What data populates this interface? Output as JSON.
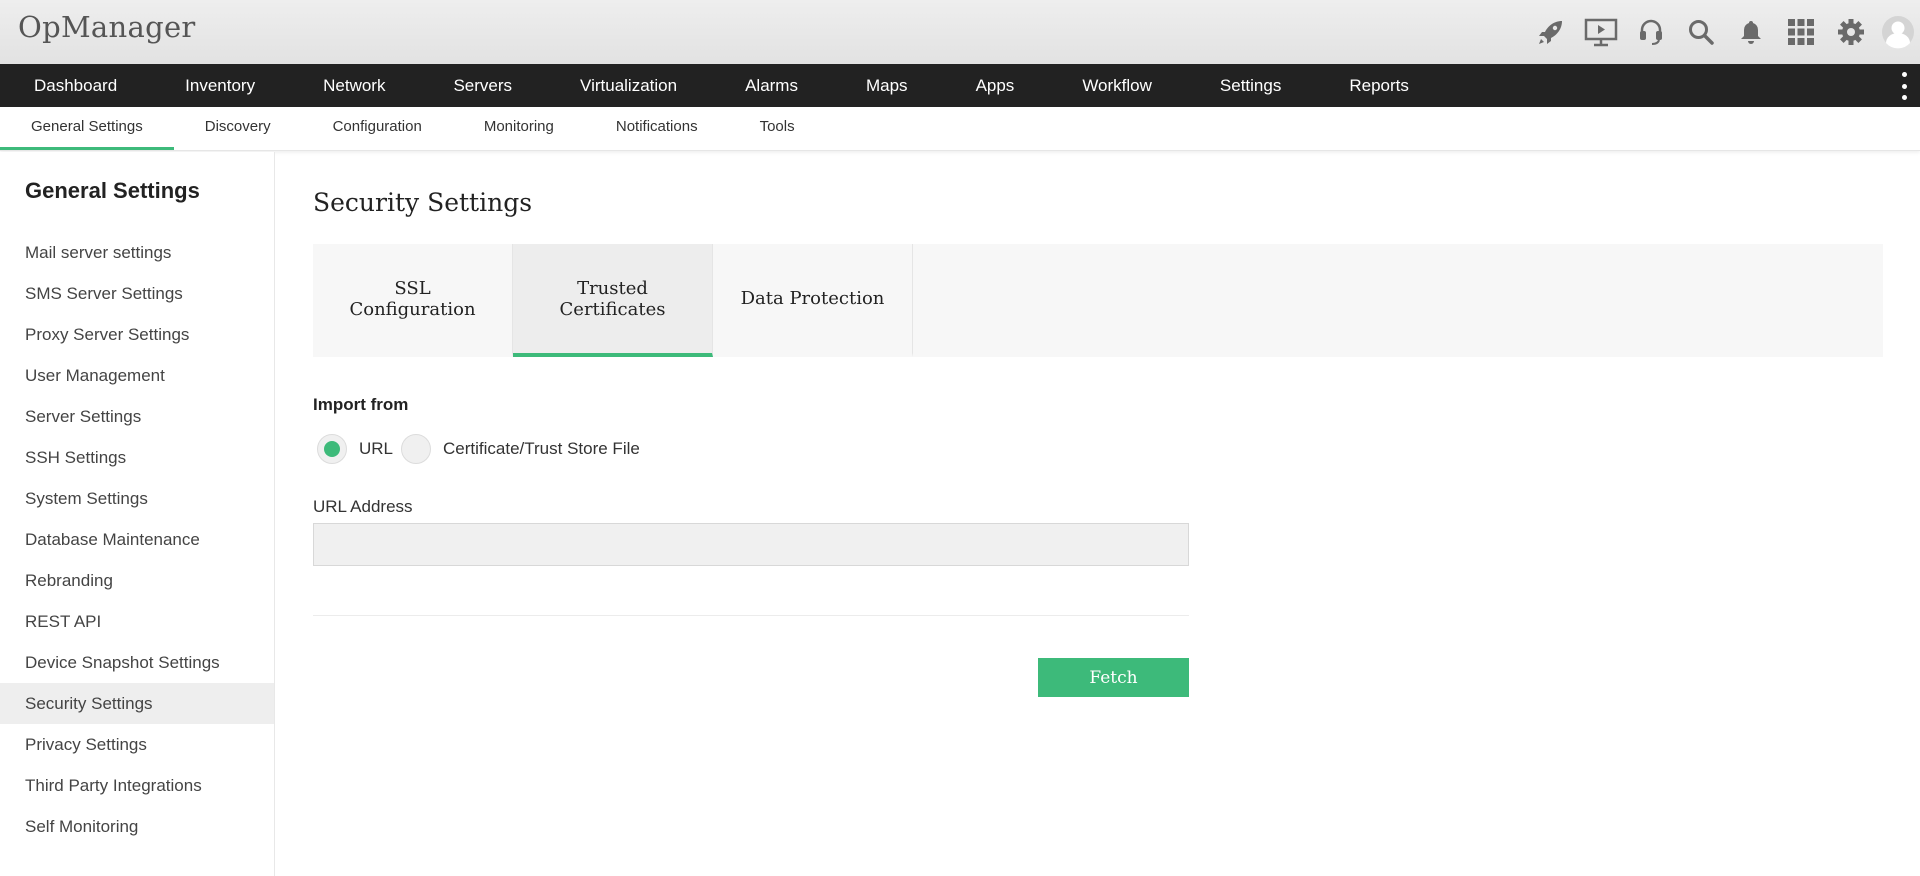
{
  "app": {
    "title": "OpManager"
  },
  "header": {
    "icons": [
      "rocket-icon",
      "presentation-icon",
      "headset-icon",
      "search-icon",
      "bell-icon",
      "apps-grid-icon",
      "gear-icon",
      "user-avatar-icon"
    ]
  },
  "main_nav": {
    "items": [
      "Dashboard",
      "Inventory",
      "Network",
      "Servers",
      "Virtualization",
      "Alarms",
      "Maps",
      "Apps",
      "Workflow",
      "Settings",
      "Reports"
    ]
  },
  "sub_nav": {
    "items": [
      "General Settings",
      "Discovery",
      "Configuration",
      "Monitoring",
      "Notifications",
      "Tools"
    ],
    "active": "General Settings"
  },
  "sidebar": {
    "title": "General Settings",
    "items": [
      "Mail server settings",
      "SMS Server Settings",
      "Proxy Server Settings",
      "User Management",
      "Server Settings",
      "SSH Settings",
      "System Settings",
      "Database Maintenance",
      "Rebranding",
      "REST API",
      "Device Snapshot Settings",
      "Security Settings",
      "Privacy Settings",
      "Third Party Integrations",
      "Self Monitoring"
    ],
    "active": "Security Settings"
  },
  "main": {
    "title": "Security Settings",
    "tabs": [
      {
        "line1": "SSL",
        "line2": "Configuration"
      },
      {
        "line1": "Trusted",
        "line2": "Certificates"
      },
      {
        "line1": "Data Protection",
        "line2": ""
      }
    ],
    "active_tab": "Trusted Certificates",
    "import_label": "Import from",
    "radio_options": [
      "URL",
      "Certificate/Trust Store File"
    ],
    "radio_selected": "URL",
    "url_label": "URL Address",
    "url_value": "",
    "url_placeholder": "",
    "fetch_label": "Fetch"
  },
  "colors": {
    "accent": "#3dba7a",
    "nav_bg": "#222222",
    "header_bg": "#e8e8e8"
  }
}
